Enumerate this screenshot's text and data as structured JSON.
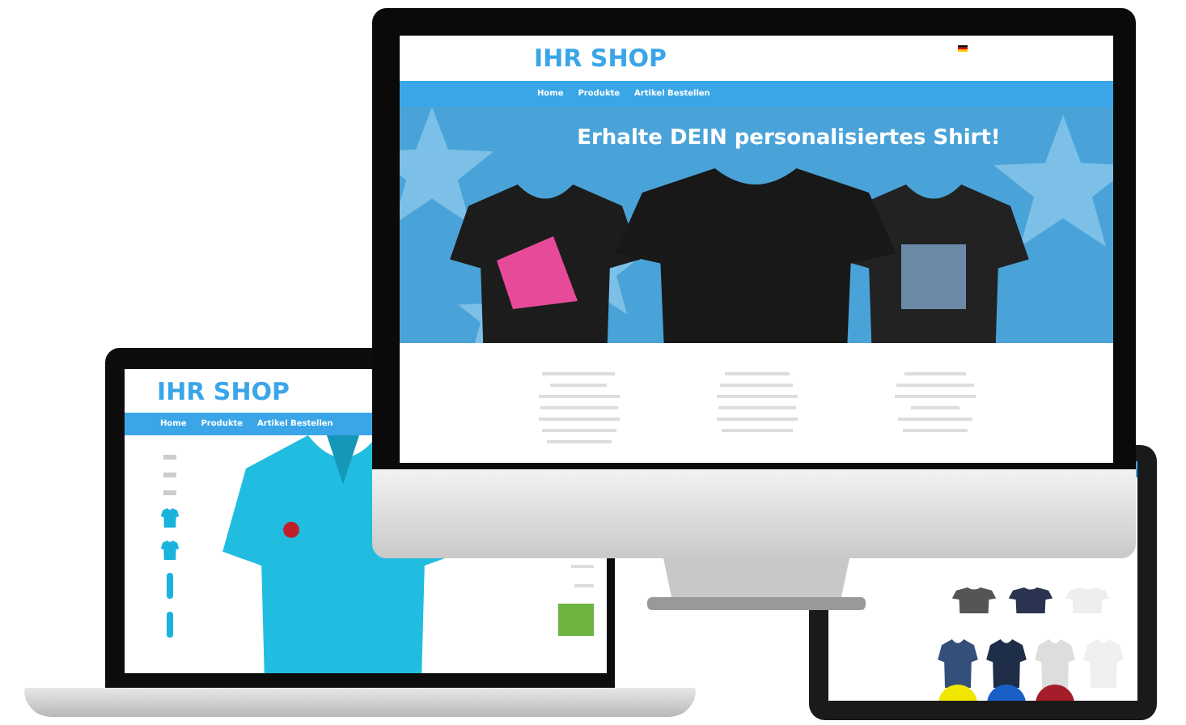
{
  "desktop": {
    "logo": "IHR SHOP",
    "nav": [
      "Home",
      "Produkte",
      "Artikel Bestellen"
    ],
    "banner_headline": "Erhalte DEIN personalisiertes Shirt!"
  },
  "laptop": {
    "logo": "IHR SHOP",
    "nav": [
      "Home",
      "Produkte",
      "Artikel Bestellen"
    ]
  }
}
